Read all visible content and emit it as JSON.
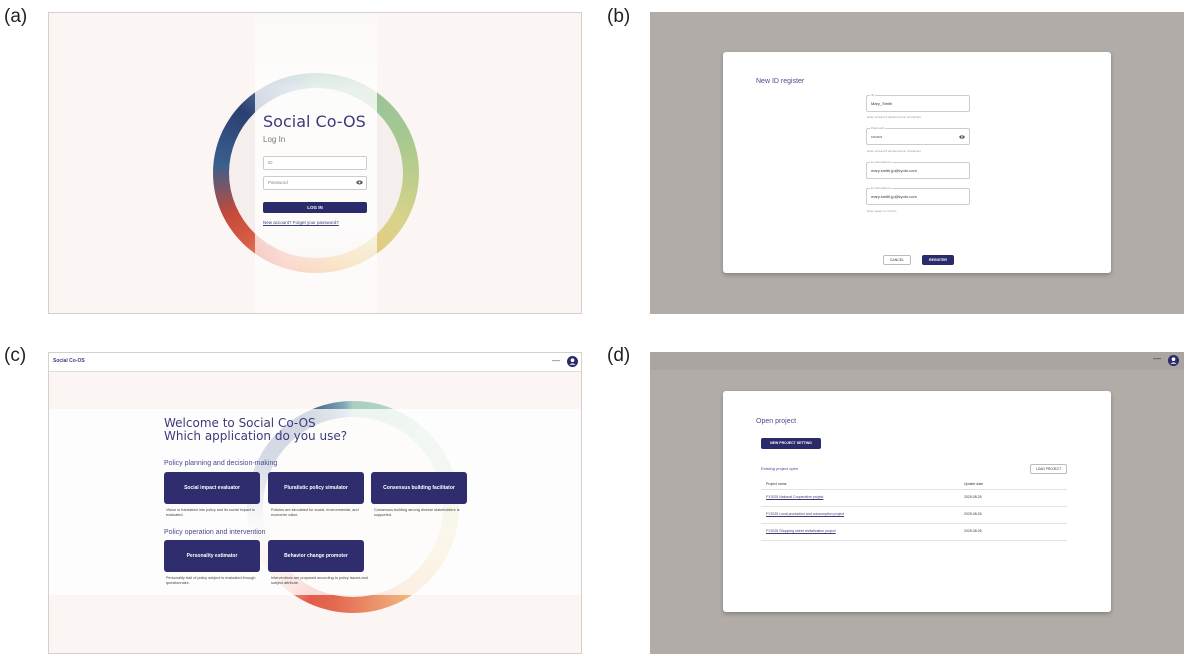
{
  "panel_labels": {
    "a": "(a)",
    "b": "(b)",
    "c": "(c)",
    "d": "(d)"
  },
  "colors": {
    "primary": "#2b2a6b",
    "accent_text": "#3c3b7a",
    "overlay": "#b1aca8",
    "page_bg": "#fbf6f3"
  },
  "login": {
    "title": "Social Co-OS",
    "subtitle": "Log In",
    "id_placeholder": "ID",
    "password_placeholder": "Password",
    "login_button": "LOG IN",
    "new_account": "New account?",
    "forgot_password": "Forget your password?"
  },
  "register": {
    "title": "New ID register",
    "fields": [
      {
        "label": "ID",
        "value": "Mary_Smith",
        "help": "Enter at least 6 alphanumeric characters"
      },
      {
        "label": "Password",
        "value": "••••••••",
        "help": "Enter at least 8 alphanumeric characters"
      },
      {
        "label": "E-mail address",
        "value": "mary.smith.jp@kyoto.com",
        "help": ""
      },
      {
        "label": "E-mail address",
        "value": "mary.smith.jp@kyoto.com",
        "help": "Enter again to confirm"
      }
    ],
    "cancel_button": "CANCEL",
    "register_button": "REGISTER"
  },
  "home": {
    "brand": "Social Co-OS",
    "minimize_glyph": "—",
    "welcome_line1": "Welcome to Social Co-OS",
    "welcome_line2": "Which application do you use?",
    "section1": "Policy planning and decision-making",
    "section2": "Policy operation and intervention",
    "apps": [
      {
        "label": "Social impact evaluator",
        "desc": "Vision is translated into policy and its social impact is evaluated."
      },
      {
        "label": "Pluralistic policy simulator",
        "desc": "Policies are simulated for social, environmental, and economic value."
      },
      {
        "label": "Consensus building facilitator",
        "desc": "Consensus building among diverse stakeholders is supported."
      },
      {
        "label": "Personality estimator",
        "desc": "Personality trait of policy subject is evaluated through questionnaire."
      },
      {
        "label": "Behavior change promoter",
        "desc": "Interventions are proposed according to policy issues and subject attribute."
      }
    ]
  },
  "open_project": {
    "minimize_glyph": "—",
    "title": "Open project",
    "new_project_button": "NEW PROJECT SETTING",
    "existing_label": "Existing project open",
    "load_button": "LOAD PROJECT",
    "columns": [
      "Project name",
      "Update date"
    ],
    "rows": [
      {
        "name": "FY2025 National Cooperative project",
        "date": "2025.08.26"
      },
      {
        "name": "FY2025 Local production and consumption project",
        "date": "2025.08.26"
      },
      {
        "name": "FY2025 Shopping street revitalization project",
        "date": "2025.08.26"
      }
    ]
  }
}
